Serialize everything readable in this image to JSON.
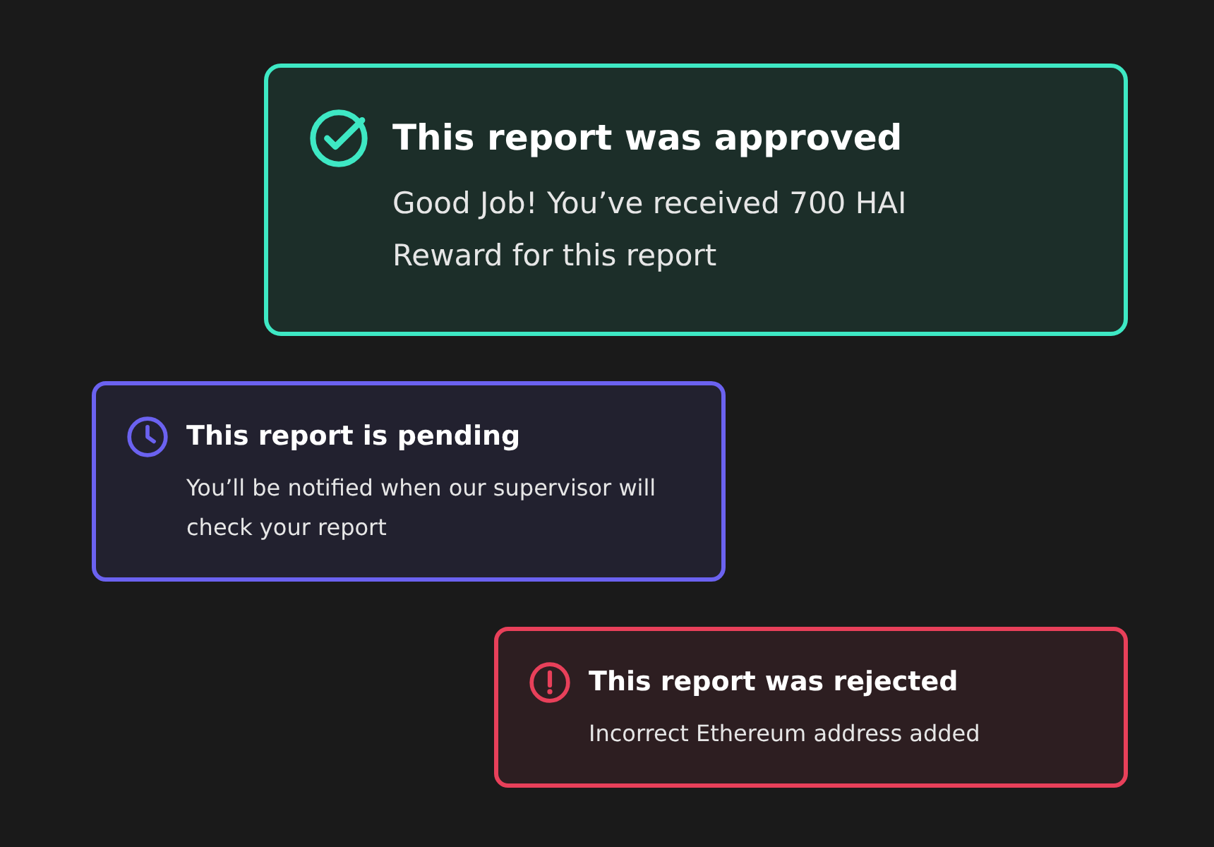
{
  "notifications": [
    {
      "kind": "approved",
      "title": "This report was approved",
      "message": "Good Job! You’ve received 700 HAI Reward for this report"
    },
    {
      "kind": "pending",
      "title": "This report is pending",
      "message": "You’ll be notified when our supervisor will check your report"
    },
    {
      "kind": "rejected",
      "title": "This report was rejected",
      "message": "Incorrect Ethereum address added"
    }
  ]
}
